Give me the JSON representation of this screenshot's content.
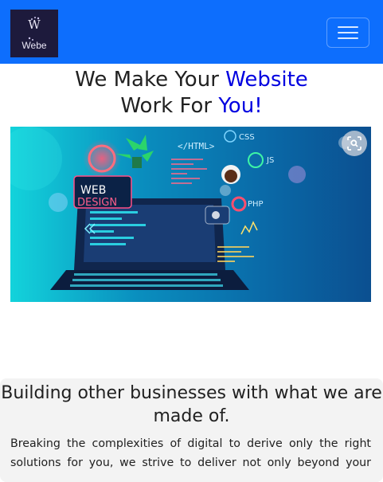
{
  "navbar": {
    "logo_text": "Webe",
    "logo_mark": "W",
    "menu_icon": "hamburger-icon",
    "bg_color": "#0d6efd"
  },
  "hero": {
    "title_part1": "We Make Your ",
    "title_accent1": "Website",
    "title_part2": "Work For ",
    "title_accent2": "You!",
    "accent_color": "#0000e0",
    "image": {
      "badge_web": "WEB",
      "badge_design": "DESIGN",
      "tag_html": "</HTML>",
      "tag_css": "CSS",
      "tag_js": "JS",
      "tag_php": "PHP"
    },
    "lens_icon": "visual-search-icon"
  },
  "section": {
    "title": "Building other businesses with what we are made of.",
    "body": "Breaking the complexities of digital to derive only the right solutions for you, we strive to deliver not only beyond your"
  }
}
